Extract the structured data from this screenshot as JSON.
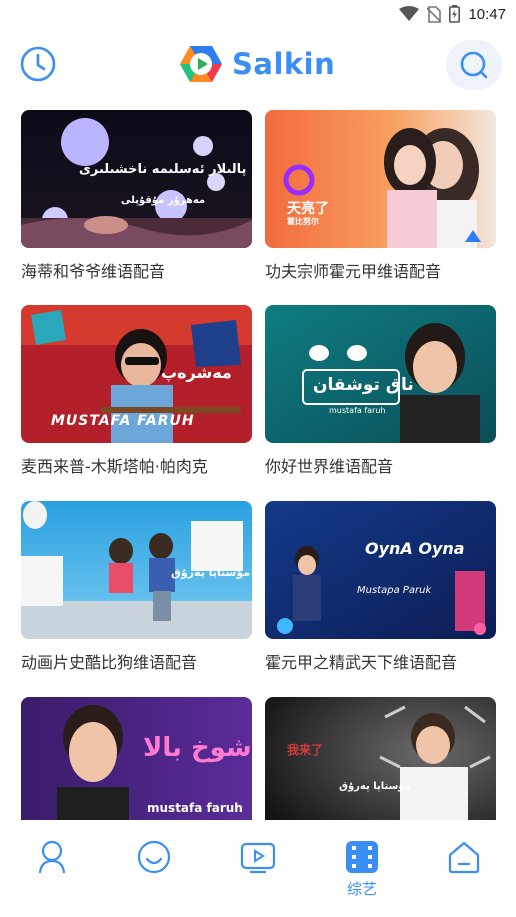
{
  "status_bar": {
    "time": "10:47"
  },
  "header": {
    "logo_text": "Salkin"
  },
  "cards": [
    {
      "title": "海蒂和爷爷维语配音",
      "overlay_1": "پالىلار ئەسلىمە ناخشىلىرى",
      "overlay_2": "مەھرۇز مۇقۇپلى"
    },
    {
      "title": "功夫宗师霍元甲维语配音",
      "overlay_1": "天亮了",
      "overlay_2": "霍比努尔"
    },
    {
      "title": "麦西来普-木斯塔帕·帕肉克",
      "overlay_1": "مەشرەپ",
      "overlay_2": "MUSTAFA FARUH"
    },
    {
      "title": "你好世界维语配音",
      "overlay_1": "ناق توشقان",
      "overlay_2": "mustafa faruh"
    },
    {
      "title": "动画片史酷比狗维语配音",
      "overlay_1": "مۇستاپا پەرۇق",
      "overlay_2": ""
    },
    {
      "title": "霍元甲之精武天下维语配音",
      "overlay_1": "OynA Oyna",
      "overlay_2": "Mustapa Paruk"
    },
    {
      "title": "",
      "overlay_1": "شوخ بالا",
      "overlay_2": "mustafa faruh"
    },
    {
      "title": "",
      "overlay_1": "我来了",
      "overlay_2": "مۇستاپا پەرۇق"
    }
  ],
  "bottom_nav": {
    "items": [
      {
        "icon": "person-icon",
        "label": ""
      },
      {
        "icon": "smile-icon",
        "label": ""
      },
      {
        "icon": "play-tv-icon",
        "label": ""
      },
      {
        "icon": "film-icon",
        "label": "综艺",
        "active": true
      },
      {
        "icon": "home-icon",
        "label": ""
      }
    ]
  },
  "colors": {
    "accent": "#3a8ef5",
    "text": "#333333"
  }
}
